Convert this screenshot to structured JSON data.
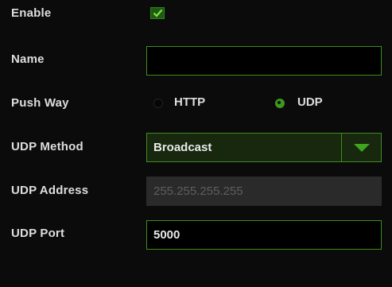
{
  "form": {
    "enable_label": "Enable",
    "enable_checked": true,
    "name_label": "Name",
    "name_value": "",
    "push_way_label": "Push Way",
    "push_way_options": [
      "HTTP",
      "UDP"
    ],
    "push_way_selected": "UDP",
    "udp_method_label": "UDP Method",
    "udp_method_value": "Broadcast",
    "udp_address_label": "UDP Address",
    "udp_address_value": "255.255.255.255",
    "udp_port_label": "UDP Port",
    "udp_port_value": "5000"
  },
  "icons": {
    "checkbox": "check-icon",
    "dropdown": "chevron-down-icon"
  },
  "colors": {
    "accent": "#3e8d1c",
    "background": "#0b0b0b",
    "text": "#dedede",
    "disabled_field": "#2a2a2a"
  }
}
